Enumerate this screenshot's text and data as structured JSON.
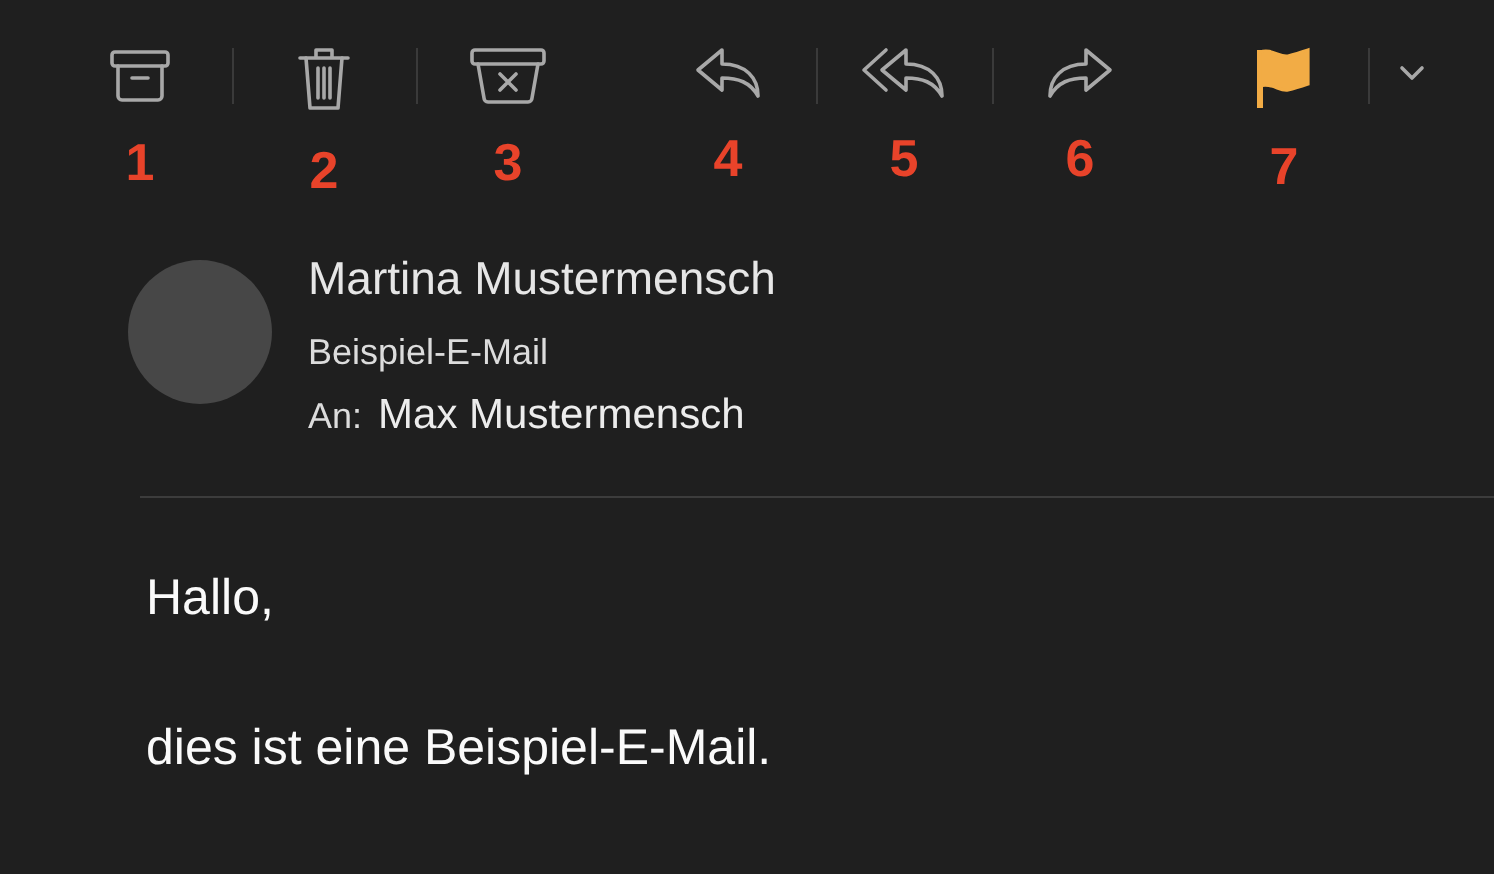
{
  "toolbar": {
    "groups": [
      [
        {
          "kind": "archive",
          "number": "1"
        },
        {
          "kind": "delete",
          "number": "2"
        },
        {
          "kind": "junk",
          "number": "3"
        }
      ],
      [
        {
          "kind": "reply",
          "number": "4"
        },
        {
          "kind": "reply-all",
          "number": "5"
        },
        {
          "kind": "forward",
          "number": "6"
        }
      ],
      [
        {
          "kind": "flag",
          "number": "7",
          "flagged": true
        },
        {
          "kind": "more"
        }
      ]
    ]
  },
  "message": {
    "sender": "Martina Mustermensch",
    "subject": "Beispiel-E-Mail",
    "to_label": "An:",
    "to": "Max Mustermensch",
    "body": [
      "Hallo,",
      "dies ist eine Beispiel-E-Mail."
    ]
  }
}
